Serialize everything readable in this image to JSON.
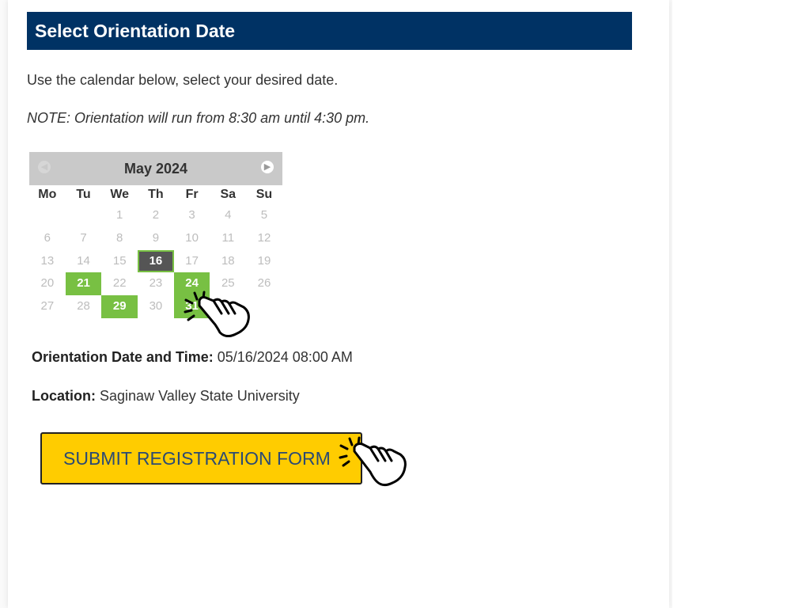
{
  "section": {
    "title": "Select Orientation Date",
    "intro": "Use the calendar below, select your desired date.",
    "note": "NOTE: Orientation will run from 8:30 am until 4:30 pm."
  },
  "calendar": {
    "month_label": "May 2024",
    "prev_icon": "chevron-left-circle-icon",
    "next_icon": "chevron-right-circle-icon",
    "weekdays": [
      "Mo",
      "Tu",
      "We",
      "Th",
      "Fr",
      "Sa",
      "Su"
    ],
    "weeks": [
      [
        "",
        "",
        "1",
        "2",
        "3",
        "4",
        "5"
      ],
      [
        "6",
        "7",
        "8",
        "9",
        "10",
        "11",
        "12"
      ],
      [
        "13",
        "14",
        "15",
        "16",
        "17",
        "18",
        "19"
      ],
      [
        "20",
        "21",
        "22",
        "23",
        "24",
        "25",
        "26"
      ],
      [
        "27",
        "28",
        "29",
        "30",
        "31",
        "",
        ""
      ]
    ],
    "selected_day": "16",
    "available_days": [
      "21",
      "24",
      "29",
      "31"
    ],
    "colors": {
      "available": "#78c043",
      "selected": "#555555",
      "header": "#c9c9c9"
    }
  },
  "details": {
    "datetime_label": "Orientation Date and Time:",
    "datetime_value": "05/16/2024 08:00 AM",
    "location_label": "Location:",
    "location_value": "Saginaw Valley State University"
  },
  "submit": {
    "label": "SUBMIT REGISTRATION FORM"
  },
  "colors": {
    "header_bg": "#003264",
    "button_bg": "#ffcc00",
    "button_text": "#2b4a74"
  }
}
